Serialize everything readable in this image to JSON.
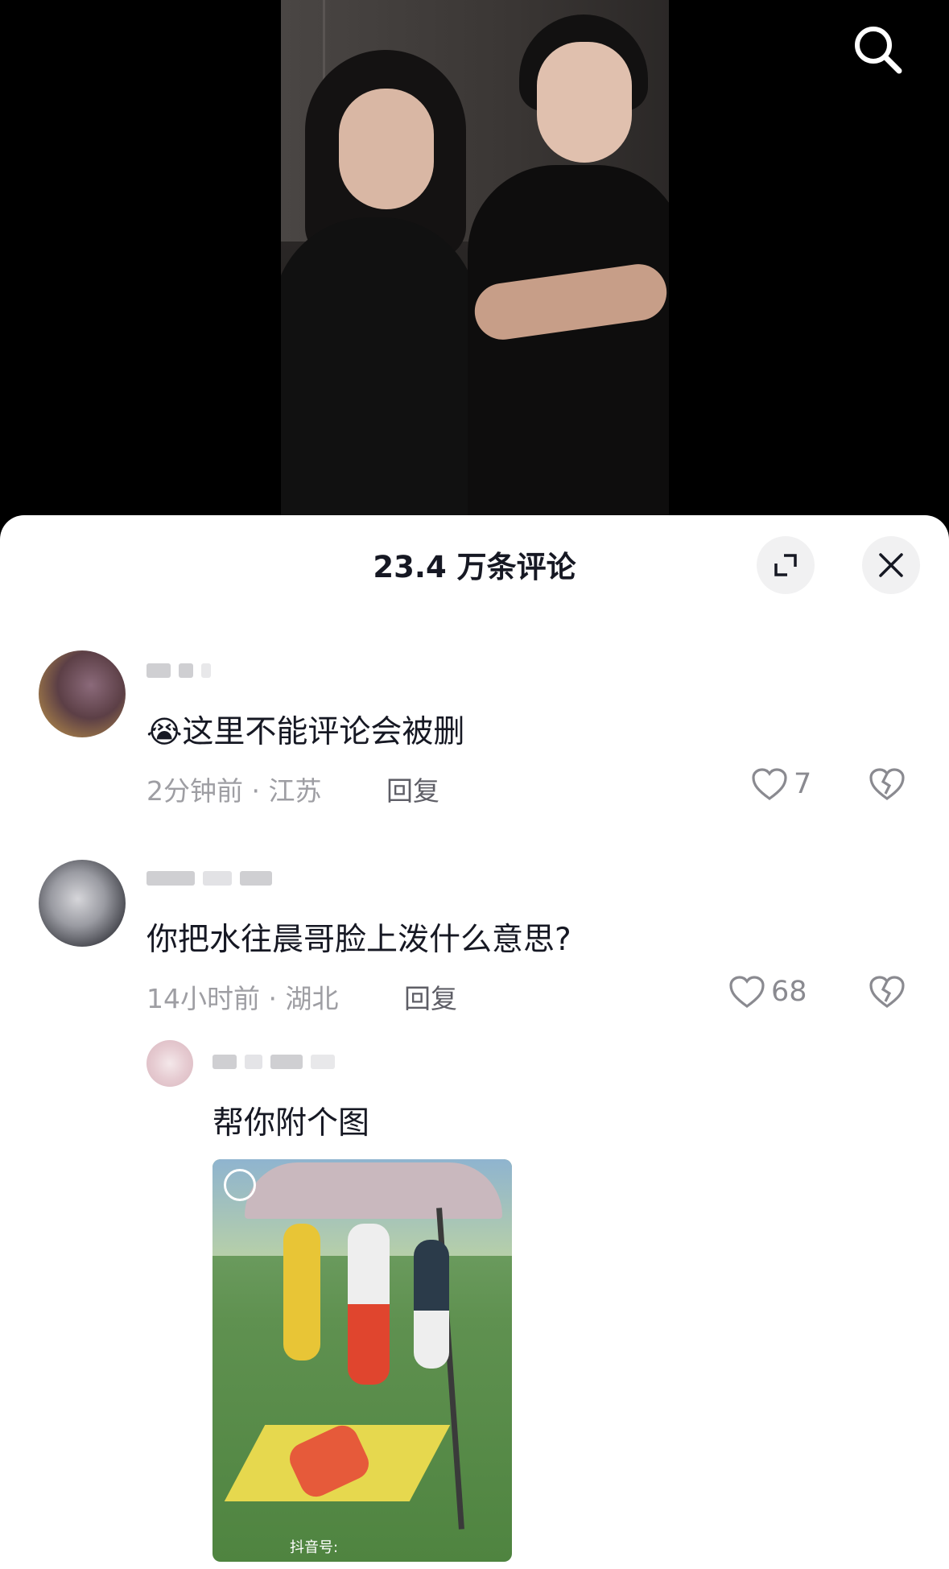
{
  "header": {
    "comment_count_title": "23.4 万条评论"
  },
  "comments": [
    {
      "text": "这里不能评论会被删",
      "emoji": "😭",
      "time_location": "2分钟前 · 江苏",
      "reply_label": "回复",
      "likes": "7"
    },
    {
      "text": "你把水往晨哥脸上泼什么意思?",
      "time_location": "14小时前 · 湖北",
      "reply_label": "回复",
      "likes": "68",
      "replies": [
        {
          "text": "帮你附个图",
          "image_watermark": "抖音号:"
        }
      ]
    }
  ],
  "colors": {
    "sheet_background": "#ffffff",
    "primary_text": "#161823",
    "secondary_text": "#9e9ea3"
  },
  "icons": [
    "search-icon",
    "expand-icon",
    "close-icon",
    "heart-icon",
    "broken-heart-icon"
  ]
}
